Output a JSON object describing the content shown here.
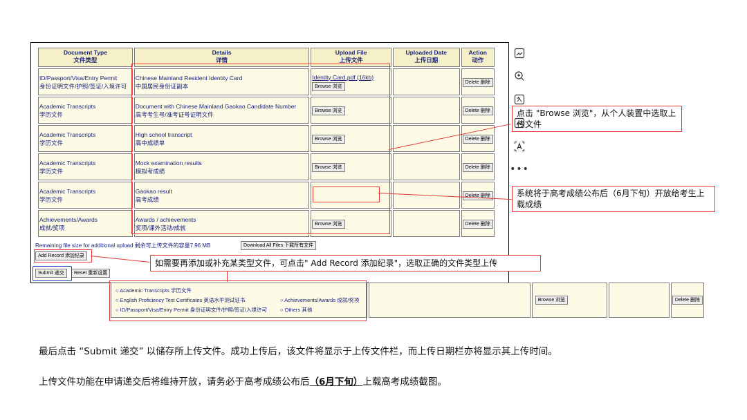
{
  "table": {
    "headers": [
      {
        "en": "Document Type",
        "zh": "文件类型"
      },
      {
        "en": "Details",
        "zh": "详情"
      },
      {
        "en": "Upload File",
        "zh": "上传文件"
      },
      {
        "en": "Uploaded Date",
        "zh": "上传日期"
      },
      {
        "en": "Action",
        "zh": "动作"
      }
    ],
    "rows": [
      {
        "type_en": "ID/Passport/Visa/Entry Permit",
        "type_zh": "身份证明文件/护照/签证/入境许可",
        "detail_en": "Chinese Mainland Resident Identity Card",
        "detail_zh": "中国居民身份证副本",
        "file_link": "Identity Card.pdf (16kb)",
        "upload": "Browse 浏览",
        "action": "Delete 删除"
      },
      {
        "type_en": "Academic Transcripts",
        "type_zh": "学历文件",
        "detail_en": "Document with Chinese Mainland Gaokao Candidate Number",
        "detail_zh": "高考考生号/准考证号证明文件",
        "file_link": "",
        "upload": "Browse 浏览",
        "action": "Delete 删除"
      },
      {
        "type_en": "Academic Transcripts",
        "type_zh": "学历文件",
        "detail_en": "High school transcript",
        "detail_zh": "高中成绩单",
        "file_link": "",
        "upload": "Browse 浏览",
        "action": "Delete 删除"
      },
      {
        "type_en": "Academic Transcripts",
        "type_zh": "学历文件",
        "detail_en": "Mock examination results",
        "detail_zh": "模拟考成绩",
        "file_link": "",
        "upload": "Browse 浏览",
        "action": "Delete 删除"
      },
      {
        "type_en": "Academic Transcripts",
        "type_zh": "学历文件",
        "detail_en": "Gaokao result",
        "detail_zh": "高考成绩",
        "file_link": "",
        "upload": "",
        "action": "Delete 删除"
      },
      {
        "type_en": "Achievements/Awards",
        "type_zh": "成就/奖项",
        "detail_en": "Awards / achievements",
        "detail_zh": "奖项/课外活动/成就",
        "file_link": "",
        "upload": "Browse 浏览",
        "action": "Delete 删除"
      }
    ]
  },
  "remaining": "Remaining file size for additional upload 剩余可上传文件的容量7.96 MB",
  "download_all": "Download All Files 下载所有文件",
  "add_record": "Add Record 添加纪录",
  "submit": "Submit 递交",
  "reset": "Reset 重新设置",
  "callouts": {
    "browse": "点击 \"Browse 浏览\"，从个人装置中选取上传文件",
    "gaokao": "系统将于高考成绩公布后（6月下旬）开放给考生上载成绩",
    "add_record": "如需要再添加或补充某类型文件，可点击\" Add Record 添加纪录\"，选取正确的文件类型上传"
  },
  "options": {
    "o1": "Academic Transcripts 学历文件",
    "o2": "English Proficiency Test Certificates 英语水平测试证书",
    "o3": "Achievements/Awards 成就/奖项",
    "o4": "ID/Passport/Visa/Entry Permit 身份证明文件/护照/签证/入境许可",
    "o5": "Others 其他"
  },
  "second_row": {
    "upload": "Browse 浏览",
    "action": "Delete 删除"
  },
  "paragraphs": {
    "p1": "最后点击 “Submit 递交” 以储存所上传文件。成功上传后，该文件将显示于上传文件栏，而上传日期栏亦将显示其上传时间。",
    "p2_a": "上传文件功能在申请递交后将维持开放，请务必于高考成绩公布后",
    "p2_b": "（6月下旬）",
    "p2_c": "上载高考成绩截图。"
  },
  "side_icons": [
    "image-edit-icon",
    "zoom-in-icon",
    "image-translate-icon",
    "image-edit-icon",
    "text-recognition-icon",
    "more-icon"
  ]
}
